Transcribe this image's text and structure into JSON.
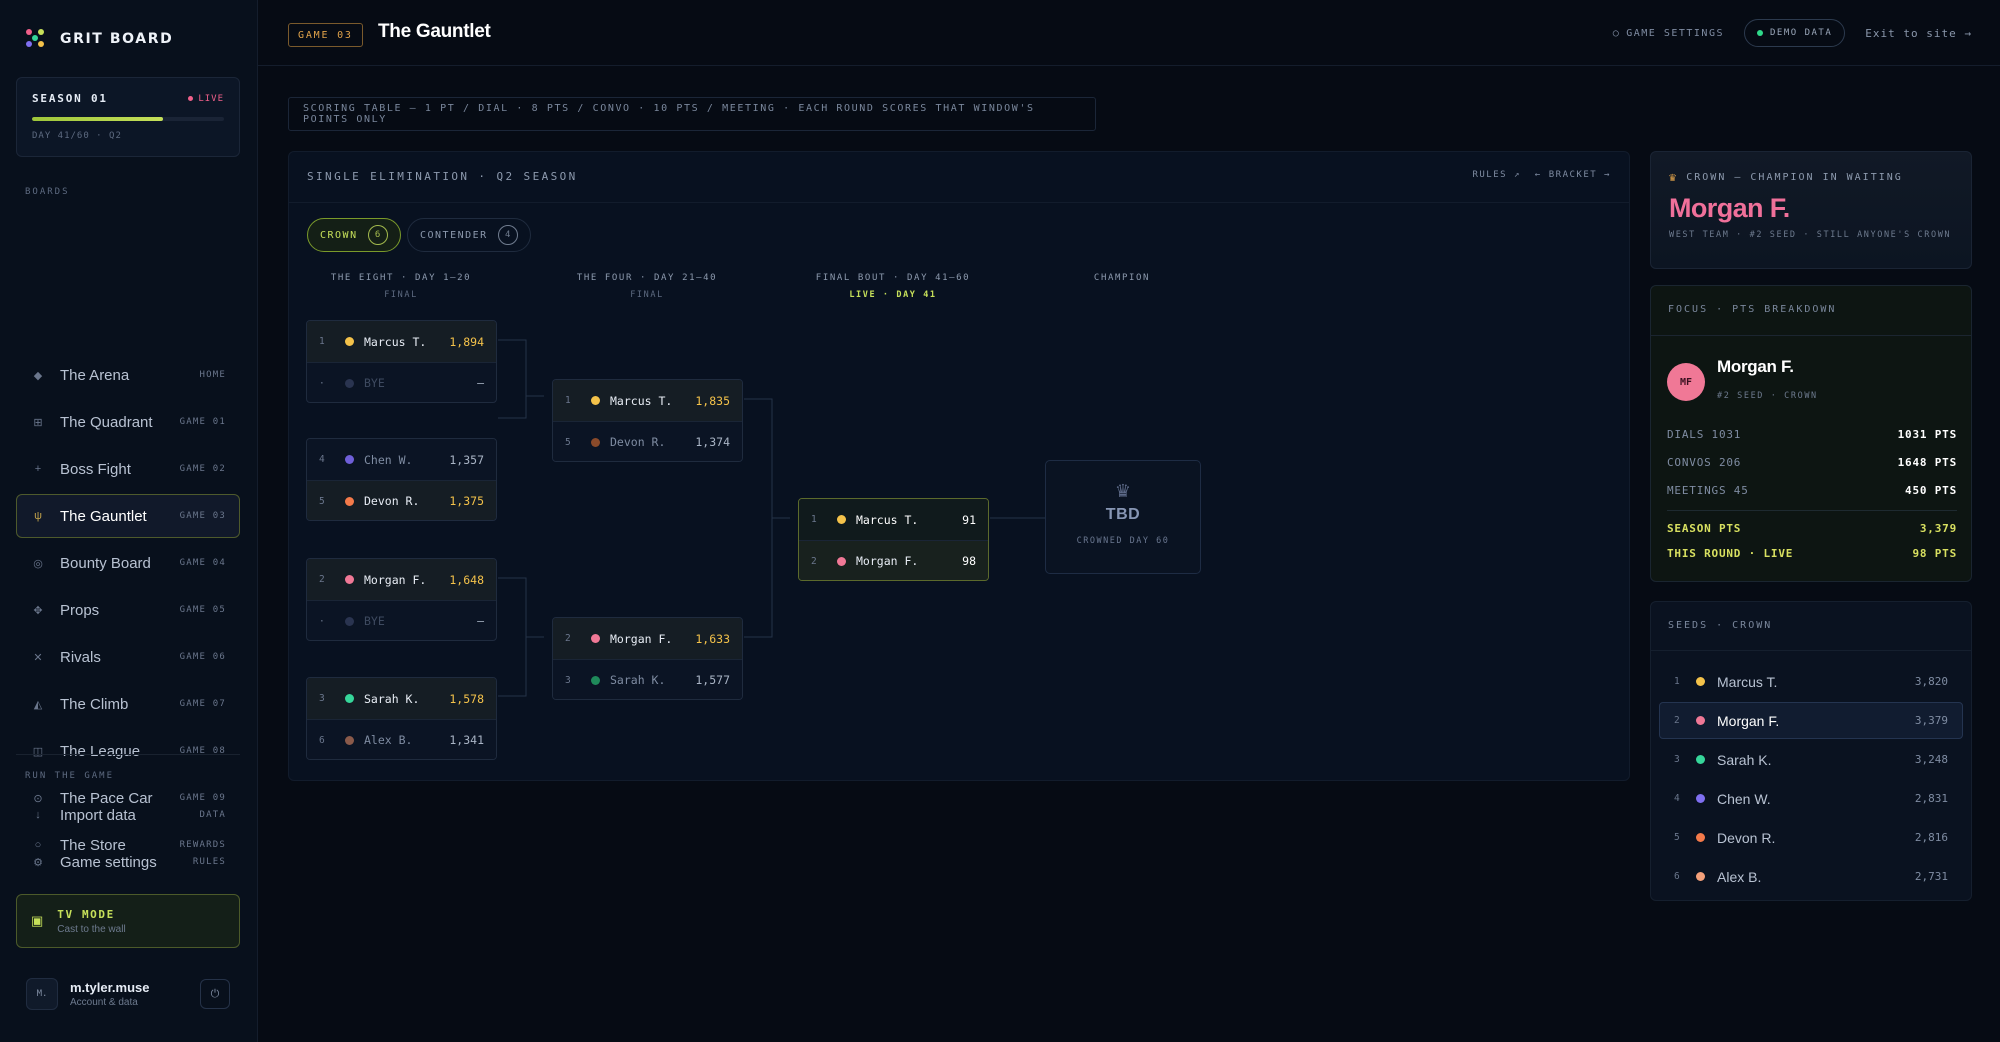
{
  "brand": {
    "title": "GRIT BOARD"
  },
  "season": {
    "name": "SEASON 01",
    "status": "LIVE",
    "day": "DAY 41/60 · Q2",
    "progress": 0.683
  },
  "sidebar": {
    "boards_label": "BOARDS",
    "items": [
      {
        "label": "The Arena",
        "tag": "HOME",
        "icon": "diamond-icon",
        "glyph": "◆"
      },
      {
        "label": "The Quadrant",
        "tag": "GAME 01",
        "icon": "grid-icon",
        "glyph": "⊞"
      },
      {
        "label": "Boss Fight",
        "tag": "GAME 02",
        "icon": "crosshair-icon",
        "glyph": "+"
      },
      {
        "label": "The Gauntlet",
        "tag": "GAME 03",
        "icon": "fork-icon",
        "glyph": "ψ"
      },
      {
        "label": "Bounty Board",
        "tag": "GAME 04",
        "icon": "target-icon",
        "glyph": "◎"
      },
      {
        "label": "Props",
        "tag": "GAME 05",
        "icon": "clover-icon",
        "glyph": "✥"
      },
      {
        "label": "Rivals",
        "tag": "GAME 06",
        "icon": "swords-icon",
        "glyph": "✕"
      },
      {
        "label": "The Climb",
        "tag": "GAME 07",
        "icon": "mountain-icon",
        "glyph": "◭"
      },
      {
        "label": "The League",
        "tag": "GAME 08",
        "icon": "table-icon",
        "glyph": "◫"
      },
      {
        "label": "The Pace Car",
        "tag": "GAME 09",
        "icon": "gauge-icon",
        "glyph": "⊙"
      },
      {
        "label": "The Store",
        "tag": "REWARDS",
        "icon": "circle-icon",
        "glyph": "○"
      }
    ],
    "run_label": "RUN THE GAME",
    "run_items": [
      {
        "label": "Import data",
        "tag": "DATA",
        "icon": "download-icon",
        "glyph": "↓"
      },
      {
        "label": "Game settings",
        "tag": "RULES",
        "icon": "gear-icon",
        "glyph": "⚙"
      }
    ],
    "tv": {
      "title": "TV MODE",
      "sub": "Cast to the wall"
    },
    "user": {
      "initials": "M.",
      "name": "m.tyler.muse",
      "sub": "Account & data"
    }
  },
  "header": {
    "game_chip": "GAME 03",
    "title": "The Gauntlet",
    "settings_link": "GAME SETTINGS",
    "demo_label": "DEMO DATA",
    "exit_link": "Exit to site →"
  },
  "scoring": "SCORING TABLE — 1 PT / DIAL · 8 PTS / CONVO · 10 PTS / MEETING · EACH ROUND SCORES THAT WINDOW'S POINTS ONLY",
  "bracket": {
    "title": "SINGLE ELIMINATION · Q2 SEASON",
    "links": [
      "RULES ↗",
      "← BRACKET →"
    ],
    "tabs": [
      {
        "label": "CROWN",
        "count": "6"
      },
      {
        "label": "CONTENDER",
        "count": "4"
      }
    ],
    "rounds": [
      {
        "name": "THE EIGHT · DAY 1–20",
        "sub": "FINAL"
      },
      {
        "name": "THE FOUR · DAY 21–40",
        "sub": "FINAL"
      },
      {
        "name": "FINAL BOUT · DAY 41–60",
        "sub": "LIVE · DAY 41"
      },
      {
        "name": "CHAMPION",
        "sub": ""
      }
    ],
    "matches": [
      [
        {
          "seed": "1",
          "name": "Marcus T.",
          "score": "1,894",
          "color": "#f4c24a",
          "state": "win"
        },
        {
          "seed": "·",
          "name": "BYE",
          "score": "–",
          "color": "#2a3450",
          "state": "bye"
        }
      ],
      [
        {
          "seed": "4",
          "name": "Chen W.",
          "score": "1,357",
          "color": "#6f5fd8",
          "state": "lose"
        },
        {
          "seed": "5",
          "name": "Devon R.",
          "score": "1,375",
          "color": "#f47a4a",
          "state": "win"
        }
      ],
      [
        {
          "seed": "2",
          "name": "Morgan F.",
          "score": "1,648",
          "color": "#f07896",
          "state": "win"
        },
        {
          "seed": "·",
          "name": "BYE",
          "score": "–",
          "color": "#2a3450",
          "state": "bye"
        }
      ],
      [
        {
          "seed": "3",
          "name": "Sarah K.",
          "score": "1,578",
          "color": "#36d69a",
          "state": "win"
        },
        {
          "seed": "6",
          "name": "Alex B.",
          "score": "1,341",
          "color": "#8a5a4a",
          "state": "lose"
        }
      ],
      [
        {
          "seed": "1",
          "name": "Marcus T.",
          "score": "1,835",
          "color": "#f4c24a",
          "state": "win"
        },
        {
          "seed": "5",
          "name": "Devon R.",
          "score": "1,374",
          "color": "#8a4a2a",
          "state": "lose"
        }
      ],
      [
        {
          "seed": "2",
          "name": "Morgan F.",
          "score": "1,633",
          "color": "#f07896",
          "state": "win"
        },
        {
          "seed": "3",
          "name": "Sarah K.",
          "score": "1,577",
          "color": "#1f8a5a",
          "state": "lose"
        }
      ],
      [
        {
          "seed": "1",
          "name": "Marcus T.",
          "score": "91",
          "color": "#f4c24a",
          "state": "win"
        },
        {
          "seed": "2",
          "name": "Morgan F.",
          "score": "98",
          "color": "#f07896",
          "state": "alt"
        }
      ]
    ],
    "champion": {
      "name": "TBD",
      "sub": "CROWNED DAY 60"
    }
  },
  "champion_card": {
    "label": "CROWN — CHAMPION IN WAITING",
    "name": "Morgan F.",
    "sub": "WEST TEAM · #2 SEED · STILL ANYONE'S CROWN"
  },
  "focus": {
    "head": "FOCUS · PTS BREAKDOWN",
    "initials": "MF",
    "name": "Morgan F.",
    "sub": "#2 SEED · CROWN",
    "rows": [
      {
        "k": "DIALS 1031",
        "v": "1031 PTS"
      },
      {
        "k": "CONVOS 206",
        "v": "1648 PTS"
      },
      {
        "k": "MEETINGS 45",
        "v": "450 PTS"
      }
    ],
    "season": {
      "k": "SEASON PTS",
      "v": "3,379"
    },
    "round": {
      "k": "THIS ROUND · LIVE",
      "v": "98 PTS"
    }
  },
  "seeds": {
    "head": "SEEDS · CROWN",
    "rows": [
      {
        "seed": "1",
        "name": "Marcus T.",
        "score": "3,820",
        "color": "#f4c24a"
      },
      {
        "seed": "2",
        "name": "Morgan F.",
        "score": "3,379",
        "color": "#f07896"
      },
      {
        "seed": "3",
        "name": "Sarah K.",
        "score": "3,248",
        "color": "#36d69a"
      },
      {
        "seed": "4",
        "name": "Chen W.",
        "score": "2,831",
        "color": "#7f6ff0"
      },
      {
        "seed": "5",
        "name": "Devon R.",
        "score": "2,816",
        "color": "#f47a4a"
      },
      {
        "seed": "6",
        "name": "Alex B.",
        "score": "2,731",
        "color": "#f4a07a"
      }
    ]
  }
}
